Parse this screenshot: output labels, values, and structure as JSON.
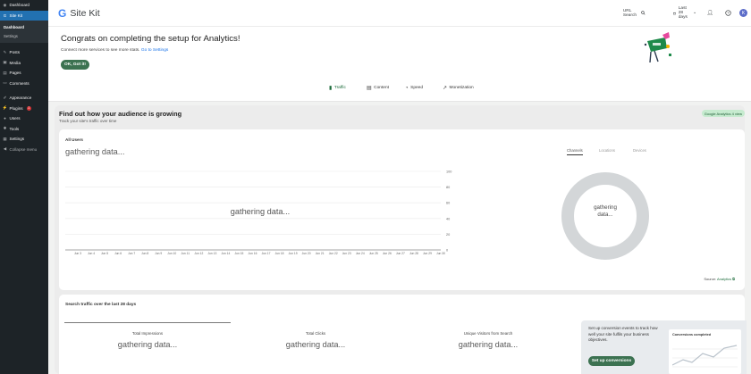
{
  "wp_menu": {
    "dashboard": "Dashboard",
    "sitekit": "Site Kit",
    "sub": [
      "Dashboard",
      "Settings"
    ],
    "items": [
      {
        "label": "Posts",
        "icon": "pin-icon"
      },
      {
        "label": "Media",
        "icon": "media-icon"
      },
      {
        "label": "Pages",
        "icon": "page-icon"
      },
      {
        "label": "Comments",
        "icon": "comment-icon"
      }
    ],
    "items2": [
      {
        "label": "Appearance",
        "icon": "brush-icon"
      },
      {
        "label": "Plugins",
        "icon": "plug-icon",
        "badge": "1"
      },
      {
        "label": "Users",
        "icon": "user-icon"
      },
      {
        "label": "Tools",
        "icon": "wrench-icon"
      },
      {
        "label": "Settings",
        "icon": "settings-icon"
      }
    ],
    "collapse": "Collapse menu"
  },
  "header": {
    "brand": "Site Kit",
    "logo_letter": "G",
    "url_search": "URL Search",
    "date_range": "Last 28 days",
    "avatar_letter": "K"
  },
  "banner": {
    "title": "Congrats on completing the setup for Analytics!",
    "desc": "Connect more services to see more stats.",
    "link": "Go to Settings",
    "button": "OK, Got it!"
  },
  "tabs": [
    {
      "label": "Traffic",
      "active": true
    },
    {
      "label": "Content",
      "active": false
    },
    {
      "label": "Speed",
      "active": false
    },
    {
      "label": "Monetization",
      "active": false
    }
  ],
  "traffic": {
    "title": "Find out how your audience is growing",
    "subtitle": "Track your site's traffic over time",
    "badge": "Google Analytics 4 view",
    "card_label": "All Users",
    "gathering": "gathering data...",
    "donut_line1": "gathering",
    "donut_line2": "data...",
    "tabs": [
      "Channels",
      "Locations",
      "Devices"
    ],
    "source_label": "Source:",
    "source_link": "Analytics"
  },
  "chart_data": {
    "type": "line",
    "title": "All Users",
    "x": [
      "Jun 3",
      "Jun 4",
      "Jun 5",
      "Jun 6",
      "Jun 7",
      "Jun 8",
      "Jun 9",
      "Jun 10",
      "Jun 11",
      "Jun 12",
      "Jun 13",
      "Jun 14",
      "Jun 15",
      "Jun 16",
      "Jun 17",
      "Jun 18",
      "Jun 19",
      "Jun 20",
      "Jun 21",
      "Jun 22",
      "Jun 23",
      "Jun 24",
      "Jun 25",
      "Jun 26",
      "Jun 27",
      "Jun 28",
      "Jun 29",
      "Jun 30"
    ],
    "yticks": [
      0,
      20,
      40,
      60,
      80,
      100
    ],
    "ylim": [
      0,
      100
    ],
    "series": [],
    "annotation": "gathering data..."
  },
  "search": {
    "title": "Search traffic over the last 28 days",
    "stats": [
      {
        "label": "Total Impressions",
        "value": "gathering data..."
      },
      {
        "label": "Total Clicks",
        "value": "gathering data..."
      },
      {
        "label": "Unique Visitors from Search",
        "value": "gathering data..."
      }
    ],
    "conversion_text": "Set up conversion events to track how well your site fulfils your business objectives.",
    "conversion_button": "Set up conversions",
    "mini_title": "Conversions completed"
  },
  "colors": {
    "accent": "#3c7251",
    "wp_sidebar": "#1d2327",
    "wp_active": "#2271b1",
    "donut": "#d3d6d8"
  }
}
